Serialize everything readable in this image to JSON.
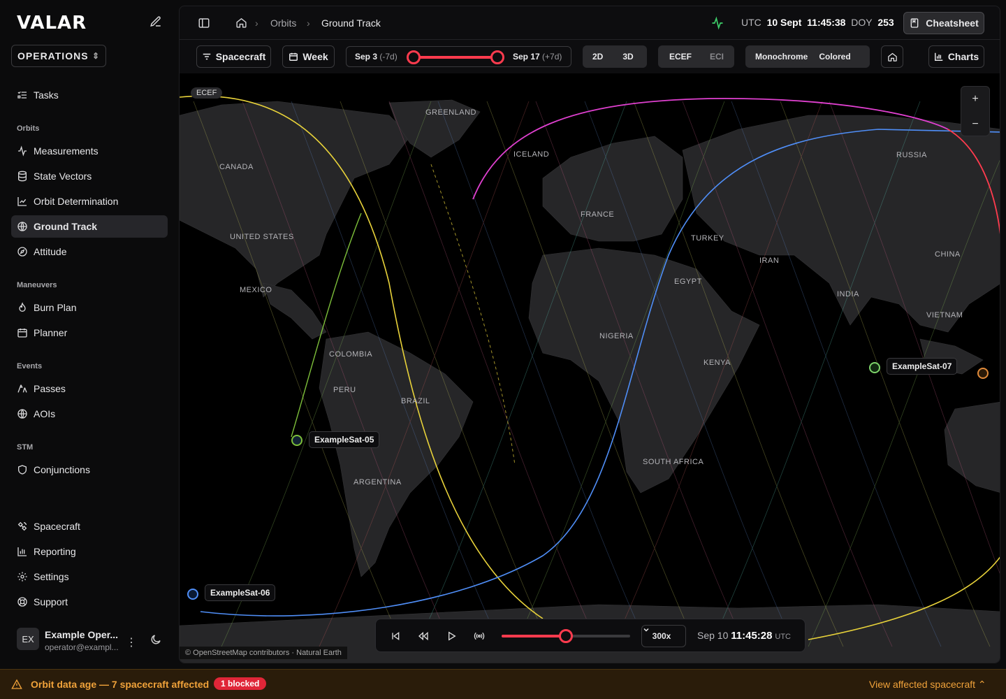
{
  "app": {
    "logo": "VALAR",
    "workspace": "OPERATIONS"
  },
  "sidebar": {
    "items": [
      {
        "label": "Tasks",
        "icon": "tasks-icon"
      },
      {
        "label": "Measurements",
        "icon": "activity-icon"
      },
      {
        "label": "State Vectors",
        "icon": "database-icon"
      },
      {
        "label": "Orbit Determination",
        "icon": "line-chart-icon"
      },
      {
        "label": "Ground Track",
        "icon": "globe-icon"
      },
      {
        "label": "Attitude",
        "icon": "compass-icon"
      },
      {
        "label": "Burn Plan",
        "icon": "flame-icon"
      },
      {
        "label": "Planner",
        "icon": "calendar-icon"
      },
      {
        "label": "Passes",
        "icon": "antenna-icon"
      },
      {
        "label": "AOIs",
        "icon": "globe-icon"
      },
      {
        "label": "Conjunctions",
        "icon": "shield-icon"
      },
      {
        "label": "Spacecraft",
        "icon": "satellite-icon"
      },
      {
        "label": "Reporting",
        "icon": "bar-chart-icon"
      },
      {
        "label": "Settings",
        "icon": "gear-icon"
      },
      {
        "label": "Support",
        "icon": "lifebuoy-icon"
      }
    ],
    "sections": {
      "orbits": "Orbits",
      "maneuvers": "Maneuvers",
      "events": "Events",
      "stm": "STM"
    },
    "user": {
      "initials": "EX",
      "name": "Example Oper...",
      "email": "operator@exampl..."
    }
  },
  "header": {
    "breadcrumb": [
      "Orbits",
      "Ground Track"
    ],
    "utc_label": "UTC",
    "date": "10 Sept",
    "time": "11:45:38",
    "doy_label": "DOY",
    "doy": "253",
    "cheatsheet": "Cheatsheet"
  },
  "toolbar": {
    "spacecraft": "Spacecraft",
    "week": "Week",
    "range_start": "Sep 3",
    "range_start_offset": "(-7d)",
    "range_end": "Sep 17",
    "range_end_offset": "(+7d)",
    "view_2d": "2D",
    "view_3d": "3D",
    "frame_ecef": "ECEF",
    "frame_eci": "ECI",
    "monochrome": "Monochrome",
    "colored": "Colored",
    "charts": "Charts"
  },
  "map": {
    "frame_badge": "ECEF",
    "zoom_in": "+",
    "zoom_out": "−",
    "countries": [
      "GREENLAND",
      "ICELAND",
      "CANADA",
      "RUSSIA",
      "FRANCE",
      "UNITED STATES",
      "TURKEY",
      "CHINA",
      "IRAN",
      "MEXICO",
      "EGYPT",
      "INDIA",
      "VIETNAM",
      "NIGERIA",
      "COLOMBIA",
      "KENYA",
      "PERU",
      "BRAZIL",
      "SOUTH AFRICA",
      "ARGENTINA"
    ],
    "satellites": [
      {
        "name": "ExampleSat-05",
        "color": "#7dbf3a"
      },
      {
        "name": "ExampleSat-06",
        "color": "#4f8ef7"
      },
      {
        "name": "ExampleSat-07",
        "color": "#7dd36a"
      }
    ],
    "attribution": "© OpenStreetMap contributors · Natural Earth"
  },
  "player": {
    "speed": "300x",
    "progress": 0.5,
    "date": "Sep 10",
    "time": "11:45:28",
    "tz": "UTC"
  },
  "alert": {
    "message": "Orbit data age — 7 spacecraft affected",
    "badge": "1 blocked",
    "action": "View affected spacecraft"
  },
  "colors": {
    "accent": "#ff3b4e",
    "warning": "#f0a23a",
    "blue_track": "#4f8ef7",
    "magenta_track": "#e040d0",
    "yellow_track": "#e8d23a"
  }
}
